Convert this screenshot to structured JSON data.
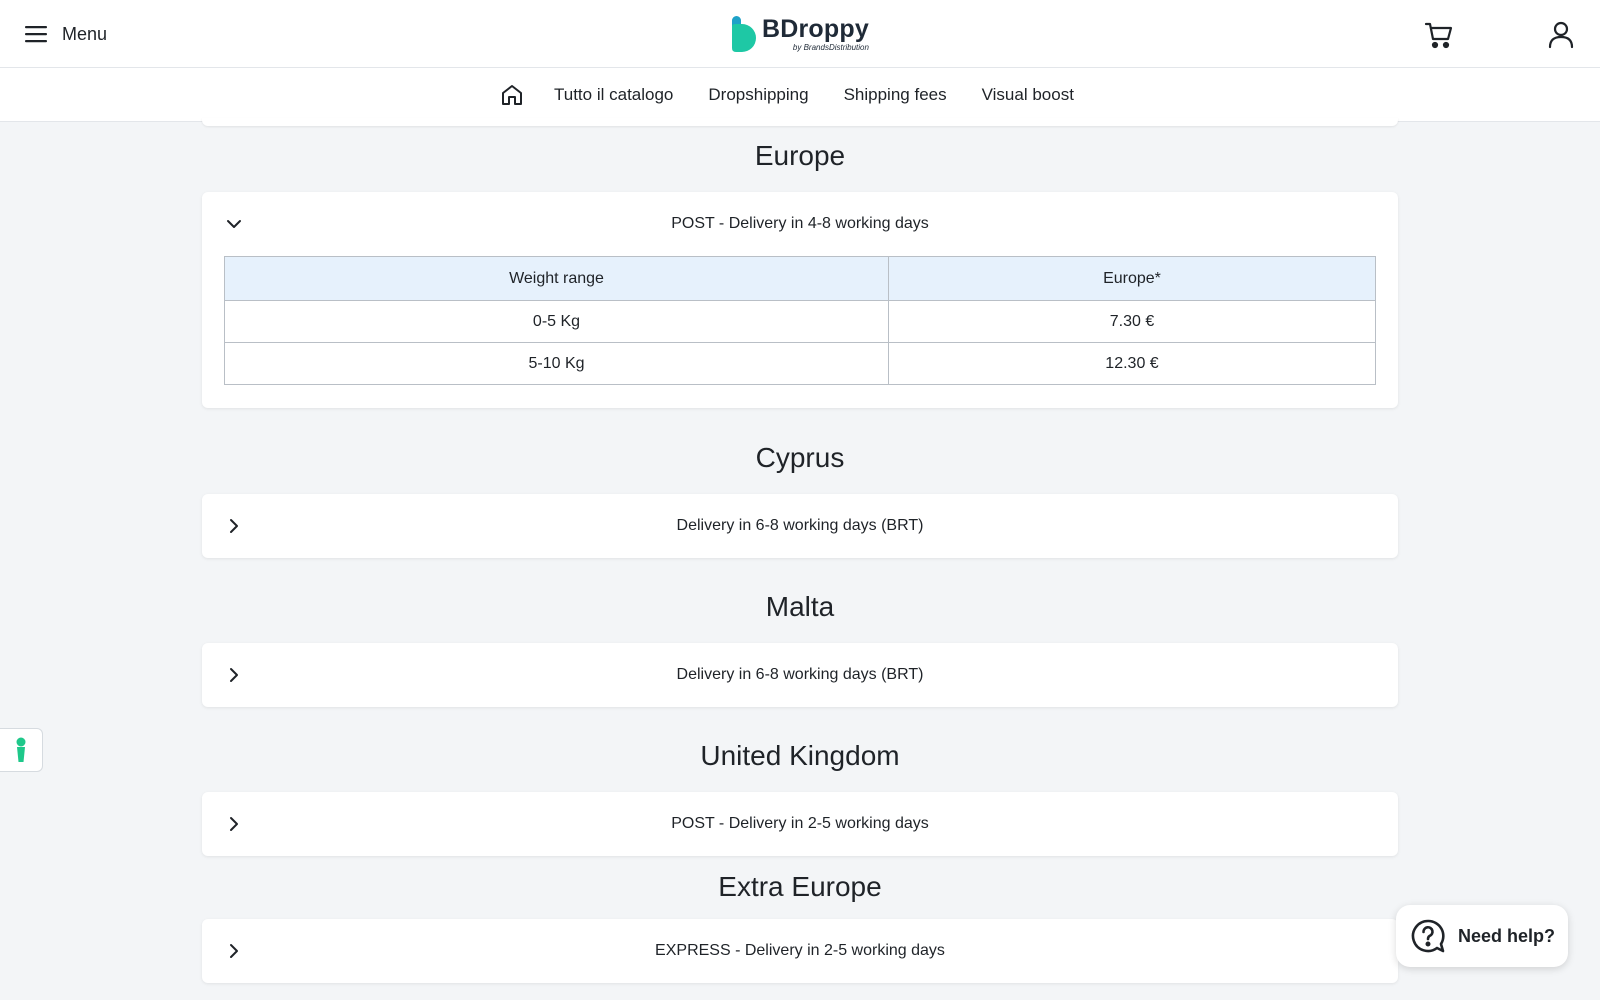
{
  "header": {
    "menu_label": "Menu",
    "brand_name": "BDroppy",
    "brand_sub": "by BrandsDistribution",
    "menu_icon": "hamburger-icon",
    "cart_icon": "cart-icon",
    "user_icon": "user-icon"
  },
  "nav": {
    "home_icon": "home-icon",
    "links": [
      "Tutto il catalogo",
      "Dropshipping",
      "Shipping fees",
      "Visual boost"
    ]
  },
  "sections": [
    {
      "title": "Europe",
      "expanded": true,
      "card_title": "POST - Delivery in 4-8 working days",
      "table": {
        "headers": [
          "Weight range",
          "Europe*"
        ],
        "rows": [
          [
            "0-5 Kg",
            "7.30 €"
          ],
          [
            "5-10 Kg",
            "12.30 €"
          ]
        ]
      }
    },
    {
      "title": "Cyprus",
      "expanded": false,
      "card_title": "Delivery in 6-8 working days (BRT)"
    },
    {
      "title": "Malta",
      "expanded": false,
      "card_title": "Delivery in 6-8 working days (BRT)"
    },
    {
      "title": "United Kingdom",
      "expanded": false,
      "card_title": "POST - Delivery in 2-5 working days"
    },
    {
      "title": "Extra Europe",
      "expanded": false,
      "card_title": "EXPRESS - Delivery in 2-5 working days"
    }
  ],
  "help": {
    "label": "Need help?"
  },
  "colors": {
    "brand_teal": "#1ec8a5",
    "table_header_bg": "#e6f1fc",
    "page_bg": "#f3f5f7"
  }
}
